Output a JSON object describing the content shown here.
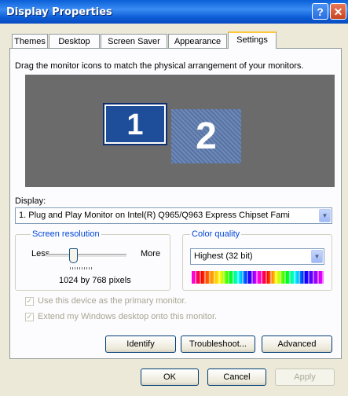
{
  "window": {
    "title": "Display Properties",
    "help_glyph": "?",
    "close_glyph": "✕"
  },
  "tabs": [
    {
      "label": "Themes"
    },
    {
      "label": "Desktop"
    },
    {
      "label": "Screen Saver"
    },
    {
      "label": "Appearance"
    },
    {
      "label": "Settings"
    }
  ],
  "active_tab": "Settings",
  "instructions": "Drag the monitor icons to match the physical arrangement of your monitors.",
  "monitors": [
    {
      "label": "1",
      "selected": true
    },
    {
      "label": "2",
      "selected": false
    }
  ],
  "display": {
    "label": "Display:",
    "value": "1. Plug and Play Monitor on Intel(R)  Q965/Q963 Express Chipset Fami"
  },
  "resolution": {
    "title": "Screen resolution",
    "less": "Less",
    "more": "More",
    "value": "1024 by 768 pixels",
    "slider_fraction": 0.3
  },
  "color_quality": {
    "title": "Color quality",
    "value": "Highest (32 bit)"
  },
  "checkboxes": [
    {
      "label": "Use this device as the primary monitor.",
      "checked": true,
      "enabled": false
    },
    {
      "label": "Extend my Windows desktop onto this monitor.",
      "checked": true,
      "enabled": false
    }
  ],
  "buttons": {
    "identify": "Identify",
    "troubleshoot": "Troubleshoot...",
    "advanced": "Advanced",
    "ok": "OK",
    "cancel": "Cancel",
    "apply": "Apply"
  },
  "colors": {
    "titlebar": "#0a5fd8",
    "group_title": "#0046d5",
    "dialog_bg": "#ECE9D8",
    "preview_bg": "#6b6b6b",
    "selected_monitor": "#1e4d9a"
  }
}
